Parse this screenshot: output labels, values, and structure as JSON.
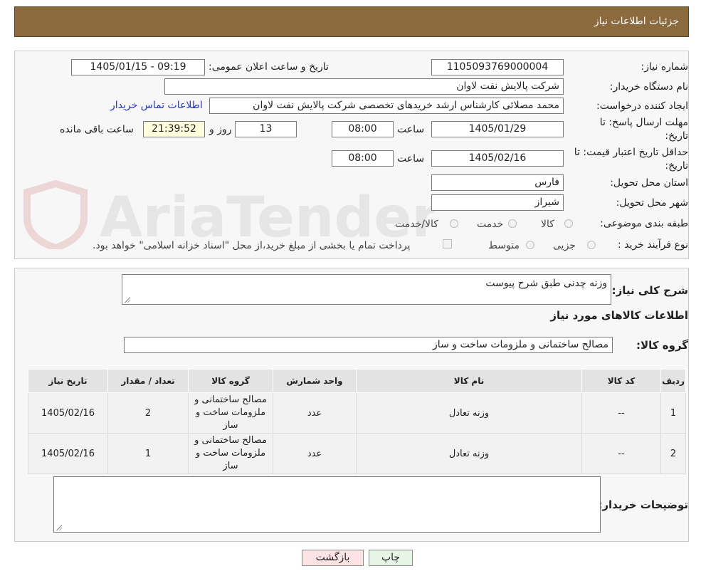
{
  "header": {
    "title": "جزئیات اطلاعات نیاز"
  },
  "form": {
    "need_number_label": "شماره نیاز:",
    "need_number": "1105093769000004",
    "announce_label": "تاریخ و ساعت اعلان عمومی:",
    "announce_value": "1405/01/15 - 09:19",
    "buyer_org_label": "نام دستگاه خریدار:",
    "buyer_org": "شرکت پالایش نفت لاوان",
    "creator_label": "ایجاد کننده درخواست:",
    "creator": "محمد مصلائی کارشناس ارشد خریدهای تخصصی شرکت پالایش نفت لاوان",
    "contact_link": "اطلاعات تماس خریدار",
    "deadline_label_1": "مهلت ارسال پاسخ: تا",
    "deadline_label_2": "تاریخ:",
    "deadline_date": "1405/01/29",
    "time_label": "ساعت",
    "deadline_time": "08:00",
    "days": "13",
    "days_label": "روز و",
    "remaining_time": "21:39:52",
    "remaining_label": "ساعت باقی مانده",
    "validity_label_1": "حداقل تاریخ اعتبار قیمت: تا",
    "validity_label_2": "تاریخ:",
    "validity_date": "1405/02/16",
    "validity_time_label": "ساعت",
    "validity_time": "08:00",
    "province_label": "استان محل تحویل:",
    "province": "فارس",
    "city_label": "شهر محل تحویل:",
    "city": "شیراز",
    "category_label": "طبقه بندی موضوعی:",
    "category_options": [
      "کالا",
      "خدمت",
      "کالا/خدمت"
    ],
    "process_label": "نوع فرآیند خرید :",
    "process_options": [
      "جزیی",
      "متوسط"
    ],
    "payment_note": "پرداخت تمام یا بخشی از مبلغ خرید،از محل \"اسناد خزانه اسلامی\" خواهد بود."
  },
  "watermark": {
    "text": "AriaTender.neT"
  },
  "details": {
    "description_label": "شرح کلی نیاز:",
    "description": "وزنه چدنی طبق شرح پیوست",
    "goods_info_title": "اطلاعات کالاهای مورد نیاز",
    "goods_group_label": "گروه کالا:",
    "goods_group": "مصالح ساختمانی و ملزومات ساخت و ساز",
    "table": {
      "headers": [
        "ردیف",
        "کد کالا",
        "نام کالا",
        "واحد شمارش",
        "گروه کالا",
        "تعداد / مقدار",
        "تاریخ نیاز"
      ],
      "rows": [
        [
          "1",
          "--",
          "وزنه تعادل",
          "عدد",
          "مصالح ساختمانی و ملزومات ساخت و ساز",
          "2",
          "1405/02/16"
        ],
        [
          "2",
          "--",
          "وزنه تعادل",
          "عدد",
          "مصالح ساختمانی و ملزومات ساخت و ساز",
          "1",
          "1405/02/16"
        ]
      ]
    },
    "buyer_notes_label": "توضیحات خریدار:",
    "buyer_notes": ""
  },
  "buttons": {
    "print": "چاپ",
    "back": "بازگشت"
  },
  "colors": {
    "header_bg": "#8b6a3e",
    "back_bg": "#fde3e3",
    "print_bg": "#e6f5e6",
    "link": "#2233cc"
  }
}
